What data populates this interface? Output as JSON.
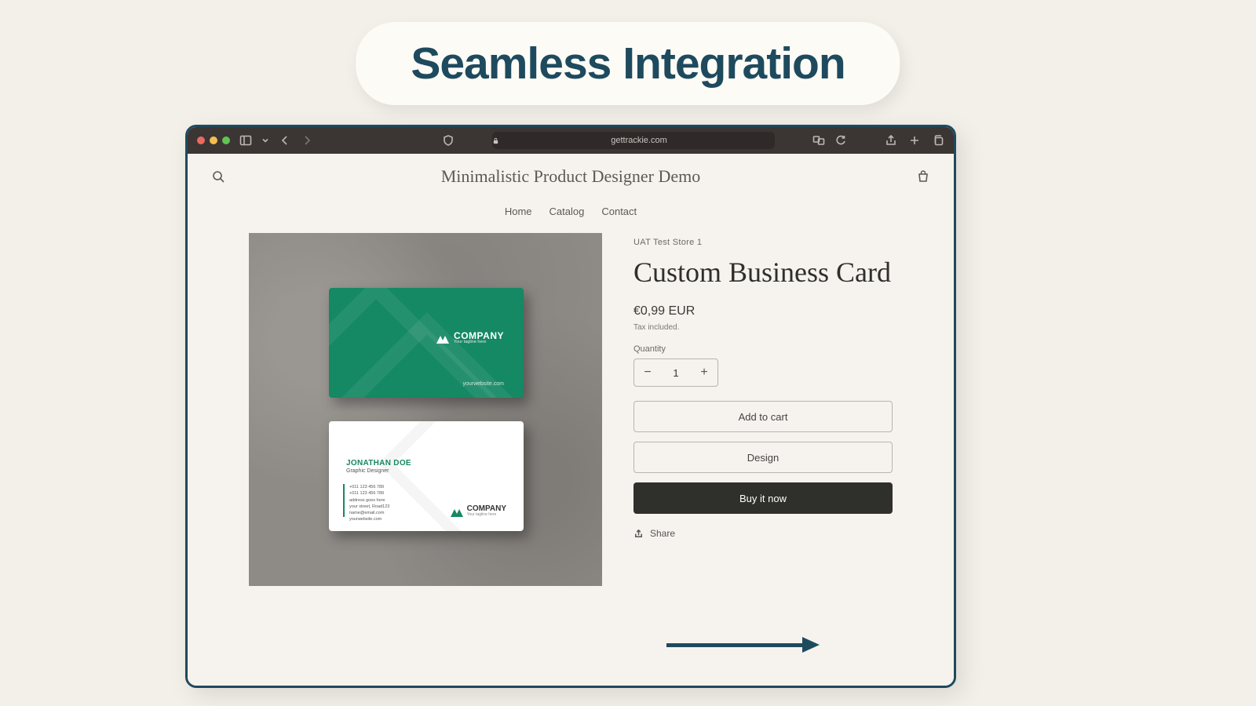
{
  "banner": {
    "headline": "Seamless Integration"
  },
  "toolbar": {
    "url": "gettrackie.com"
  },
  "store": {
    "title": "Minimalistic Product Designer Demo",
    "nav": [
      "Home",
      "Catalog",
      "Contact"
    ]
  },
  "product": {
    "vendor": "UAT Test Store 1",
    "title": "Custom Business Card",
    "price": "€0,99 EUR",
    "tax_note": "Tax included.",
    "quantity_label": "Quantity",
    "quantity": "1",
    "buttons": {
      "add_to_cart": "Add to cart",
      "design": "Design",
      "buy_now": "Buy it now"
    },
    "share": "Share"
  },
  "card": {
    "front": {
      "company": "COMPANY",
      "tagline": "Your tagline here",
      "website": "yourwebsite.com"
    },
    "back": {
      "name": "JONATHAN DOE",
      "role": "Graphic Designer",
      "phone1": "+011 123 456 789",
      "phone2": "+011 123 456 789",
      "addr1": "address goes here",
      "addr2": "your street, Road123",
      "email": "name@email.com",
      "website": "yourwebsite.com",
      "company": "COMPANY",
      "tagline": "Your tagline here"
    }
  }
}
